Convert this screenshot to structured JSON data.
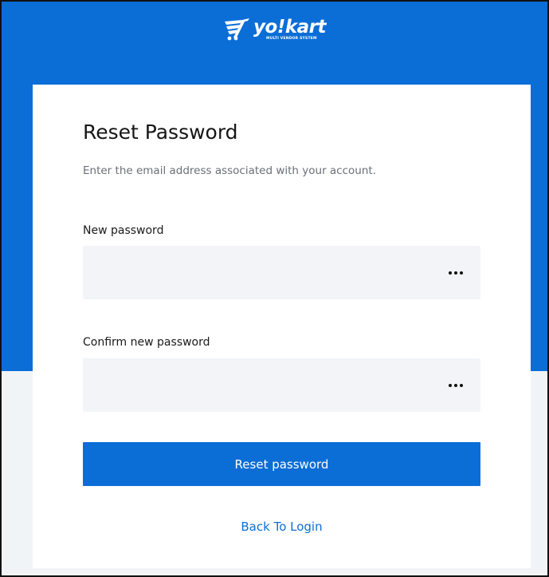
{
  "brand": {
    "name": "yo!kart",
    "tagline": "MULTI VENDOR SYSTEM",
    "logo_icon": "cart-icon",
    "primary_color": "#0b6ed7"
  },
  "form": {
    "title": "Reset Password",
    "subtitle": "Enter the email address associated with your account.",
    "new_password_label": "New password",
    "new_password_value": "",
    "confirm_password_label": "Confirm new password",
    "confirm_password_value": "",
    "toggle_icon": "more-dots-icon",
    "submit_label": "Reset password",
    "back_link_label": "Back To Login"
  }
}
